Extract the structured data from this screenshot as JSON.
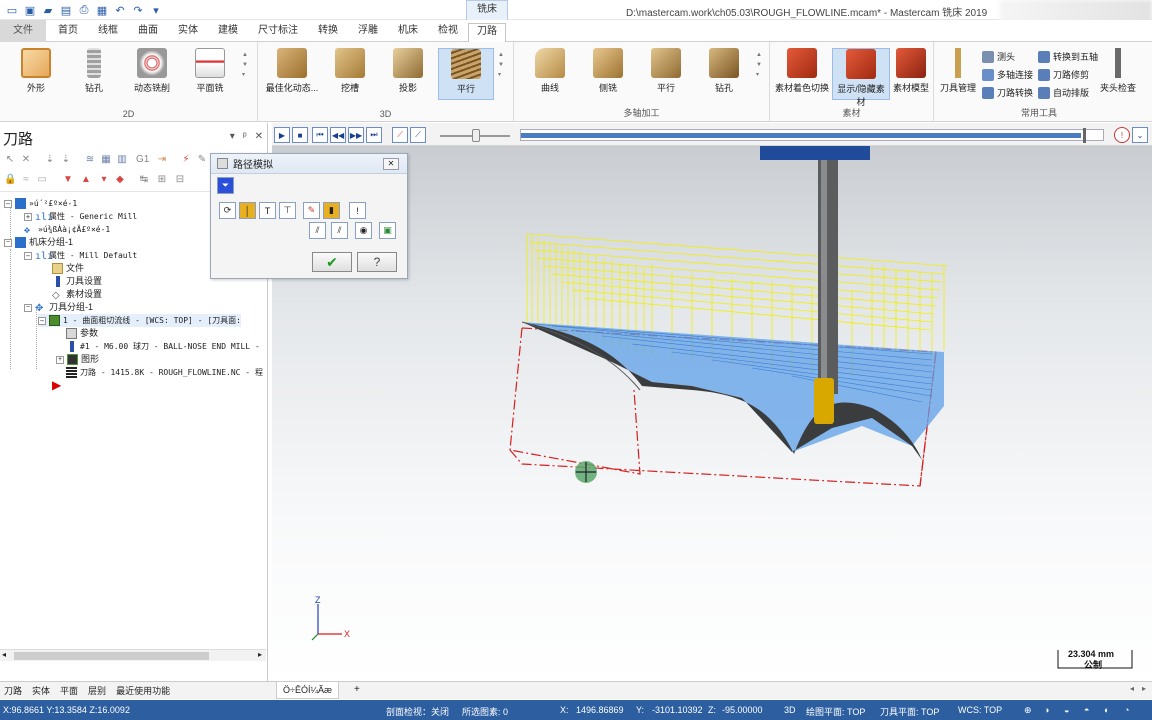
{
  "titlebar": {
    "context_tab": "铣床",
    "window_title": "D:\\mastercam.work\\ch05.03\\ROUGH_FLOWLINE.mcam* - Mastercam 铣床 2019"
  },
  "tabs": [
    "文件",
    "首页",
    "线框",
    "曲面",
    "实体",
    "建模",
    "尺寸标注",
    "转换",
    "浮雕",
    "机床",
    "检视",
    "刀路"
  ],
  "active_tab": "刀路",
  "ribbon": {
    "group_2d": {
      "label": "2D",
      "buttons": [
        "外形",
        "钻孔",
        "动态铣削",
        "平面铣"
      ]
    },
    "group_3d": {
      "label": "3D",
      "buttons": [
        "最佳化动态...",
        "挖槽",
        "投影",
        "平行"
      ]
    },
    "group_multiaxis": {
      "label": "多轴加工",
      "buttons": [
        "曲线",
        "侧铣",
        "平行",
        "钻孔"
      ]
    },
    "group_stock": {
      "label": "素材",
      "buttons": [
        "素材着色切换",
        "显示/隐藏素材",
        "素材模型"
      ]
    },
    "group_tools": {
      "label": "常用工具",
      "tool_manager": "刀具管理",
      "probe": "测头",
      "multi_link": "多轴连接",
      "path_transform": "刀路转换",
      "to_five_axis": "转换到五轴",
      "path_trim": "刀路修剪",
      "auto_layout": "自动排版",
      "fixture_check": "夹头检查"
    }
  },
  "left_panel": {
    "title": "刀路",
    "pin": "ᵖ",
    "tree": [
      {
        "label": "»ú´²£º×é-1",
        "level": 0
      },
      {
        "label": "属性 - Generic Mill",
        "level": 1
      },
      {
        "label": "»ú¾ßÀà¡¢Ä£º×é-1",
        "level": 1
      },
      {
        "label": "机床分组-1",
        "level": 0
      },
      {
        "label": "属性 - Mill Default",
        "level": 1
      },
      {
        "label": "文件",
        "level": 2
      },
      {
        "label": "刀具设置",
        "level": 2
      },
      {
        "label": "素材设置",
        "level": 2
      },
      {
        "label": "刀具分组-1",
        "level": 1
      },
      {
        "label": "1 - 曲面粗切流线 - [WCS: TOP] - [刀具面:",
        "level": 2
      },
      {
        "label": "参数",
        "level": 3
      },
      {
        "label": "#1 - M6.00 球刀 - BALL-NOSE END MILL -",
        "level": 3
      },
      {
        "label": "图形",
        "level": 3
      },
      {
        "label": "刀路 - 1415.8K - ROUGH_FLOWLINE.NC - 程",
        "level": 3
      }
    ],
    "bottom_tabs": [
      "刀路",
      "实体",
      "平面",
      "层别",
      "最近使用功能"
    ]
  },
  "dialog": {
    "title": "路径模拟",
    "close": "✕"
  },
  "viewport": {
    "axis_z": "Z",
    "axis_x": "X",
    "scale_value": "23.304 mm",
    "scale_unit": "公制",
    "view_tab": "Ö÷ÊÓÍ¼Ãæ"
  },
  "statusbar": {
    "coords_left": "X:96.8661  Y:13.3584  Z:16.0092",
    "section_view": "剖面检视：关闭",
    "selected": "所选图素: 0",
    "x": "X:",
    "x_val": "1496.86869",
    "y": "Y:",
    "y_val": "-3101.10392",
    "z": "Z:",
    "z_val": "-95.00000",
    "mode": "3D",
    "cplane": "绘图平面: TOP",
    "tplane": "刀具平面: TOP",
    "wcs": "WCS: TOP"
  },
  "colors": {
    "accent": "#2c5ea0",
    "toolpath_yellow": "#f0f000",
    "toolpath_blue": "#4a90e2",
    "stock_red": "#d62020"
  }
}
